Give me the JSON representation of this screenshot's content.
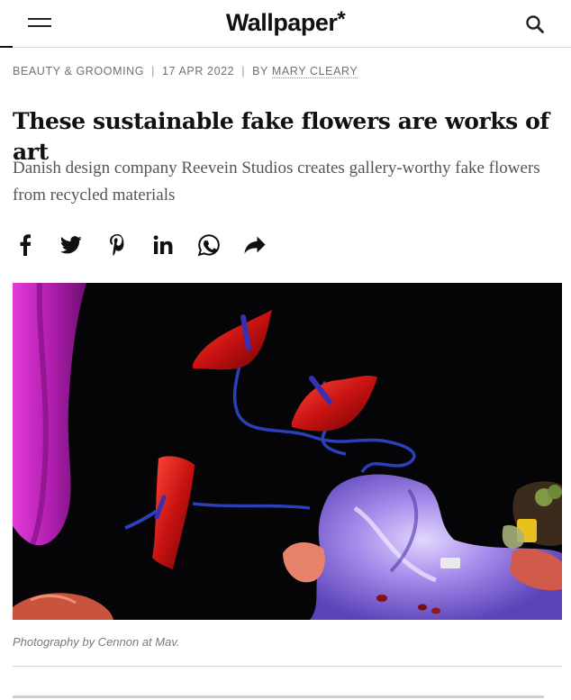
{
  "header": {
    "logo_text": "Wallpaper",
    "logo_star": "*",
    "menu_icon": "hamburger-icon",
    "search_icon": "search-icon"
  },
  "article": {
    "category": "BEAUTY & GROOMING",
    "date": "17 APR 2022",
    "by_prefix": "BY",
    "author": "MARY CLEARY",
    "separator": "|",
    "title": "These sustainable fake flowers are works of art",
    "subtitle": "Danish design company Reevein Studios creates gallery-worthy fake flowers from recycled materials",
    "caption": "Photography by Cennon at Mav."
  },
  "share": {
    "icons": [
      "facebook-icon",
      "twitter-icon",
      "pinterest-icon",
      "linkedin-icon",
      "whatsapp-icon",
      "share-icon"
    ]
  },
  "colors": {
    "text": "#111111",
    "meta": "#707070",
    "subtitle": "#555555",
    "hero_background": "#050507",
    "magenta_fabric": "#b21fb0",
    "lilac_fabric": "#a28ae0",
    "flower_red": "#c21010",
    "stem_blue": "#2a3fb8"
  }
}
